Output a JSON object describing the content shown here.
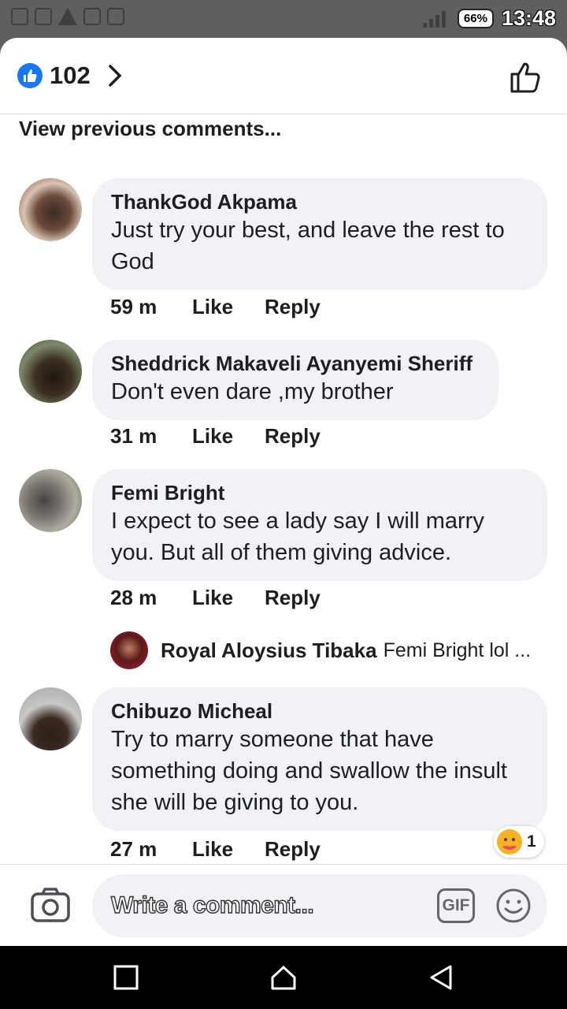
{
  "status_bar": {
    "battery": "66%",
    "time": "13:48"
  },
  "reactions": {
    "count": "102"
  },
  "view_previous": "View previous comments...",
  "comments": [
    {
      "author": "ThankGod Akpama",
      "text": "Just try your best, and leave the rest to God",
      "time": "59 m",
      "like": "Like",
      "reply": "Reply"
    },
    {
      "author": "Sheddrick Makaveli Ayanyemi Sheriff",
      "text": "Don't even dare ,my brother",
      "time": "31 m",
      "like": "Like",
      "reply": "Reply"
    },
    {
      "author": "Femi Bright",
      "text": "I expect to see a lady say I will marry you. But all of them giving advice.",
      "time": "28 m",
      "like": "Like",
      "reply": "Reply"
    },
    {
      "author": "Chibuzo Micheal",
      "text": "Try to marry someone that have something doing and swallow the insult she will be giving to you.",
      "time": "27 m",
      "like": "Like",
      "reply": "Reply"
    }
  ],
  "reply_preview": {
    "author": "Royal Aloysius Tibaka",
    "text": "Femi Bright lol ..."
  },
  "reaction_chip": {
    "emoji": "care-emoji",
    "count": "1"
  },
  "composer": {
    "placeholder": "Write a comment...",
    "gif_label": "GIF"
  },
  "colors": {
    "accent": "#1877f2",
    "bubble": "#f0f2f5",
    "status_bar": "#5f5f5f"
  }
}
